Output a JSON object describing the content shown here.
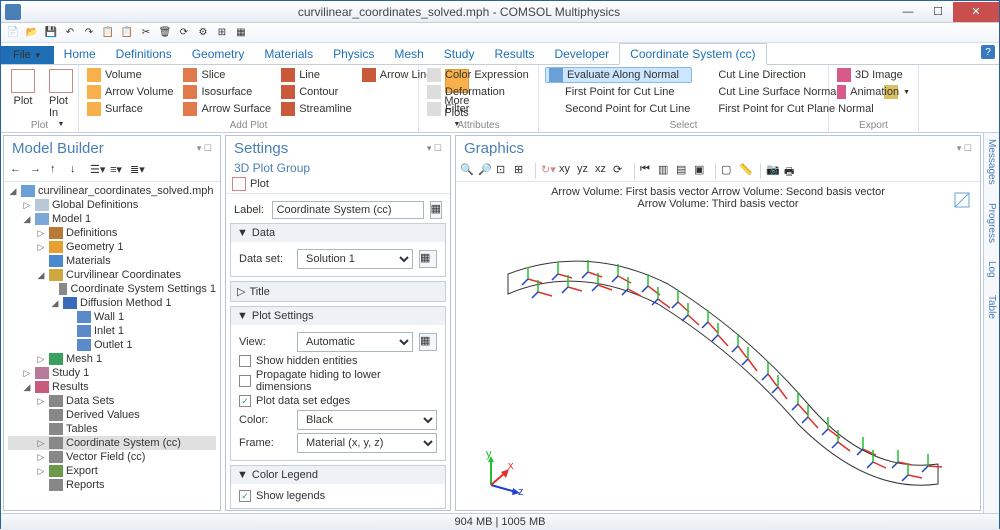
{
  "window": {
    "title": "curvilinear_coordinates_solved.mph - COMSOL Multiphysics"
  },
  "tabs": {
    "file": "File",
    "items": [
      "Home",
      "Definitions",
      "Geometry",
      "Materials",
      "Physics",
      "Mesh",
      "Study",
      "Results",
      "Developer",
      "Coordinate System (cc)"
    ]
  },
  "ribbon": {
    "plot": {
      "label": "Plot",
      "plot": "Plot",
      "plotin": "Plot\nIn"
    },
    "addplot": {
      "label": "Add Plot",
      "volume": "Volume",
      "arrowvol": "Arrow Volume",
      "surface": "Surface",
      "slice": "Slice",
      "isosurf": "Isosurface",
      "arrowsurf": "Arrow Surface",
      "line": "Line",
      "contour": "Contour",
      "streamline": "Streamline",
      "arrowline": "Arrow Line",
      "moreplots": "More\nPlots"
    },
    "attributes": {
      "label": "Attributes",
      "colorexpr": "Color Expression",
      "deformation": "Deformation",
      "filter": "Filter"
    },
    "select": {
      "label": "Select",
      "evalnormal": "Evaluate Along Normal",
      "firstpt": "First Point for Cut Line",
      "secondpt": "Second Point for Cut Line",
      "cutdir": "Cut Line Direction",
      "cutsurf": "Cut Line Surface Normal",
      "cutplane": "First Point for Cut Plane Normal"
    },
    "export": {
      "label": "Export",
      "image3d": "3D Image",
      "animation": "Animation"
    }
  },
  "modelbuilder": {
    "title": "Model Builder",
    "root": "curvilinear_coordinates_solved.mph",
    "globaldef": "Global Definitions",
    "model": "Model 1",
    "definitions": "Definitions",
    "geometry": "Geometry 1",
    "materials": "Materials",
    "curvcoord": "Curvilinear Coordinates",
    "css1": "Coordinate System Settings 1",
    "diffusion": "Diffusion Method 1",
    "wall": "Wall 1",
    "inlet": "Inlet 1",
    "outlet": "Outlet 1",
    "mesh": "Mesh 1",
    "study": "Study 1",
    "results": "Results",
    "datasets": "Data Sets",
    "derived": "Derived Values",
    "tables": "Tables",
    "coordsys": "Coordinate System (cc)",
    "vectorfield": "Vector Field (cc)",
    "export": "Export",
    "reports": "Reports"
  },
  "settings": {
    "title": "Settings",
    "subtitle": "3D Plot Group",
    "plotbtn": "Plot",
    "label_lbl": "Label:",
    "label_val": "Coordinate System (cc)",
    "sec_data": "Data",
    "dataset_lbl": "Data set:",
    "dataset_val": "Solution 1",
    "sec_title": "Title",
    "sec_plotsettings": "Plot Settings",
    "view_lbl": "View:",
    "view_val": "Automatic",
    "chk_hidden": "Show hidden entities",
    "chk_prop": "Propagate hiding to lower dimensions",
    "chk_edges": "Plot data set edges",
    "color_lbl": "Color:",
    "color_val": "Black",
    "frame_lbl": "Frame:",
    "frame_val": "Material  (x, y, z)",
    "sec_colorlegend": "Color Legend",
    "chk_legends": "Show legends"
  },
  "graphics": {
    "title": "Graphics",
    "caption1": "Arrow Volume: First basis vector  Arrow Volume: Second basis vector",
    "caption2": "Arrow Volume: Third basis vector",
    "axes": {
      "x": "x",
      "y": "y",
      "z": "z"
    }
  },
  "sidetabs": [
    "Messages",
    "Progress",
    "Log",
    "Table"
  ],
  "status": "904 MB | 1005 MB"
}
